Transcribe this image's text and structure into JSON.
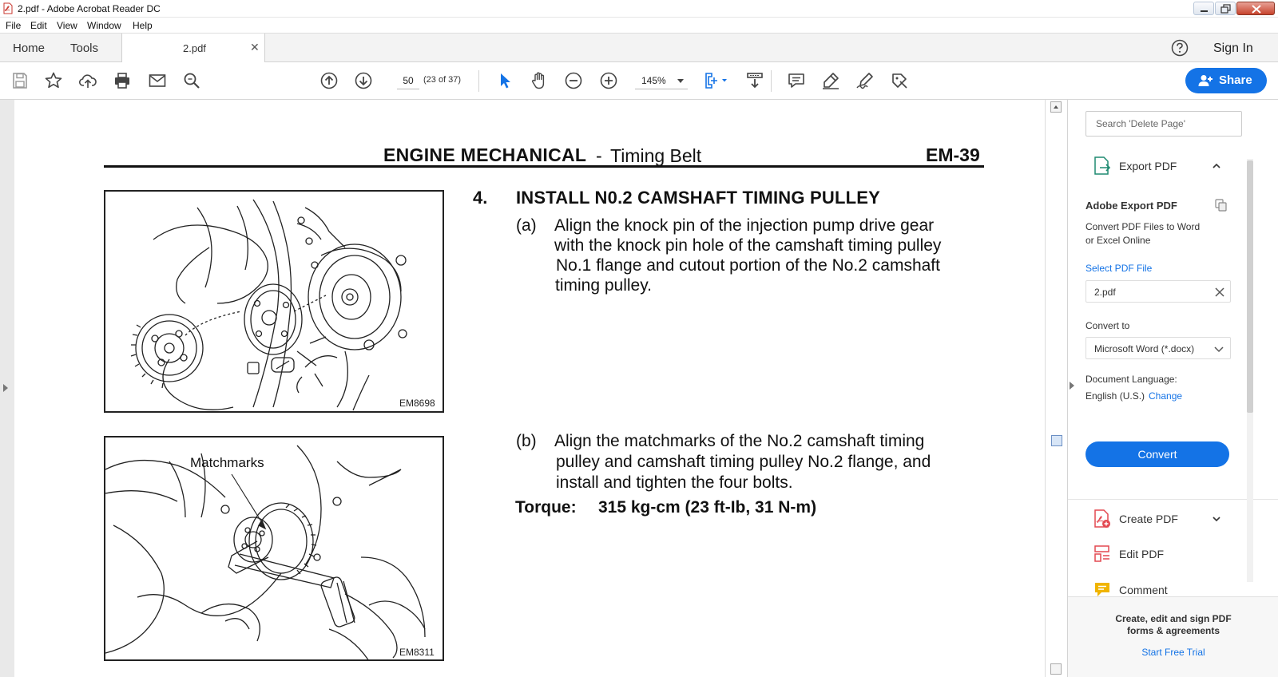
{
  "window": {
    "title": "2.pdf - Adobe Acrobat Reader DC"
  },
  "menu": [
    "File",
    "Edit",
    "View",
    "Window",
    "Help"
  ],
  "tabs": {
    "home": "Home",
    "tools": "Tools",
    "document": "2.pdf",
    "sign_in": "Sign In"
  },
  "toolbar": {
    "page_number": "50",
    "page_count": "(23 of 37)",
    "zoom": "145%",
    "share": "Share"
  },
  "document": {
    "section_title": "ENGINE  MECHANICAL",
    "section_dash": "-",
    "section_subtitle": "Timing  Belt",
    "page_code": "EM-39",
    "figure1_code": "EM8698",
    "figure2_code": "EM8311",
    "figure2_label": "Matchmarks",
    "step_number": "4.",
    "step_title": "INSTALL N0.2 CAMSHAFT TIMING PULLEY",
    "step_a": {
      "marker": "(a)",
      "lines": [
        "Align the knock pin of the injection pump drive gear",
        "with the knock pin hole of the camshaft timing pulley",
        "No.1 flange and cutout portion of the No.2 camshaft",
        "timing pulley."
      ]
    },
    "step_b": {
      "marker": "(b)",
      "lines": [
        "Align the matchmarks of the No.2 camshaft timing",
        "pulley and camshaft timing pulley No.2 flange, and",
        "install and tighten the four bolts."
      ]
    },
    "torque_label": "Torque:",
    "torque_value": "315 kg-cm (23 ft-Ib, 31  N-m)"
  },
  "right_pane": {
    "search_placeholder": "Search 'Delete Page'",
    "export_pdf": "Export PDF",
    "adobe_export_pdf": "Adobe Export PDF",
    "export_desc_1": "Convert PDF Files to Word",
    "export_desc_2": "or Excel Online",
    "select_pdf_file": "Select PDF File",
    "selected_file": "2.pdf",
    "convert_to": "Convert to",
    "convert_format": "Microsoft Word (*.docx)",
    "doc_language_label": "Document Language:",
    "doc_language": "English (U.S.)",
    "change": "Change",
    "convert": "Convert",
    "create_pdf": "Create PDF",
    "edit_pdf": "Edit PDF",
    "comment": "Comment",
    "promo_1": "Create, edit and sign PDF",
    "promo_2": "forms & agreements",
    "free_trial": "Start Free Trial"
  },
  "colors": {
    "accent": "#1473e6",
    "create_pdf_icon": "#e34850",
    "edit_pdf_icon": "#e34850",
    "comment_icon": "#f0b400"
  }
}
